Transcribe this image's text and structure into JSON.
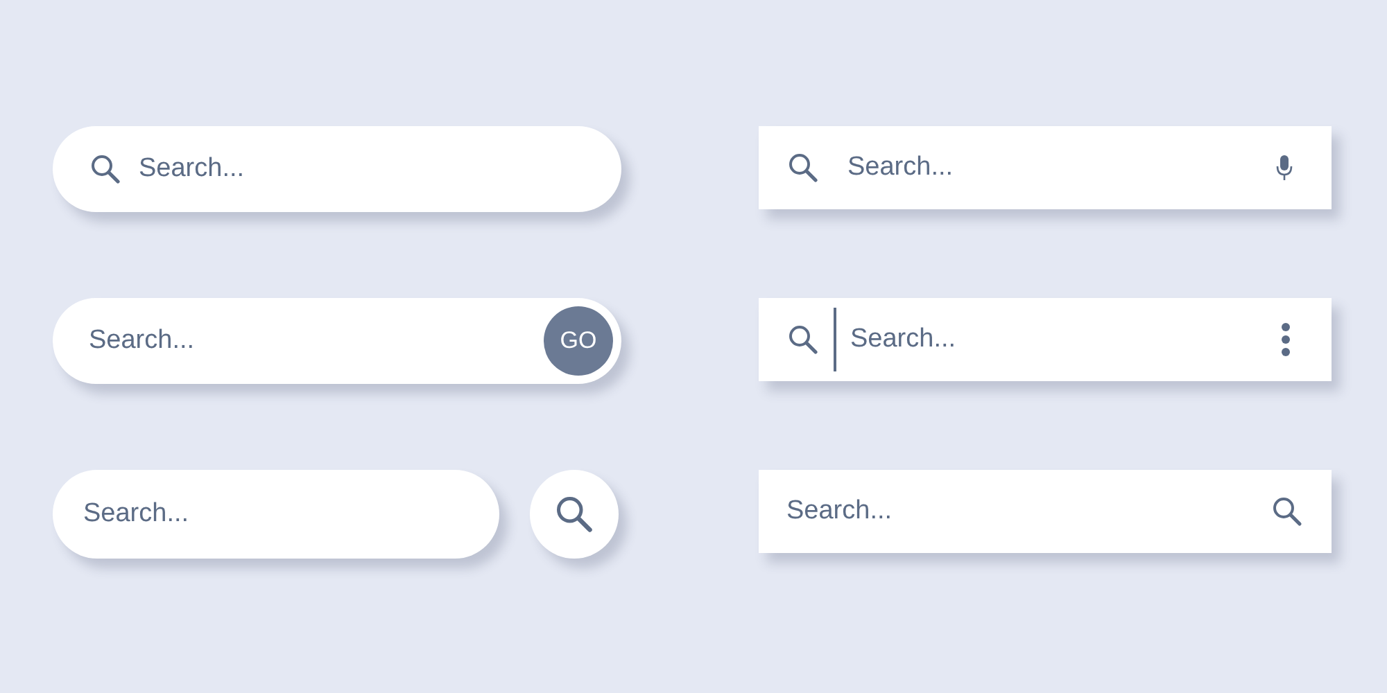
{
  "search_bars": [
    {
      "kind": "pill-icon-left",
      "placeholder": "Search..."
    },
    {
      "kind": "rect-mic",
      "placeholder": "Search..."
    },
    {
      "kind": "pill-go",
      "placeholder": "Search...",
      "button": "GO"
    },
    {
      "kind": "rect-divider-menu",
      "placeholder": "Search..."
    },
    {
      "kind": "pill-separate-button",
      "placeholder": "Search..."
    },
    {
      "kind": "rect-search-right",
      "placeholder": "Search..."
    }
  ]
}
